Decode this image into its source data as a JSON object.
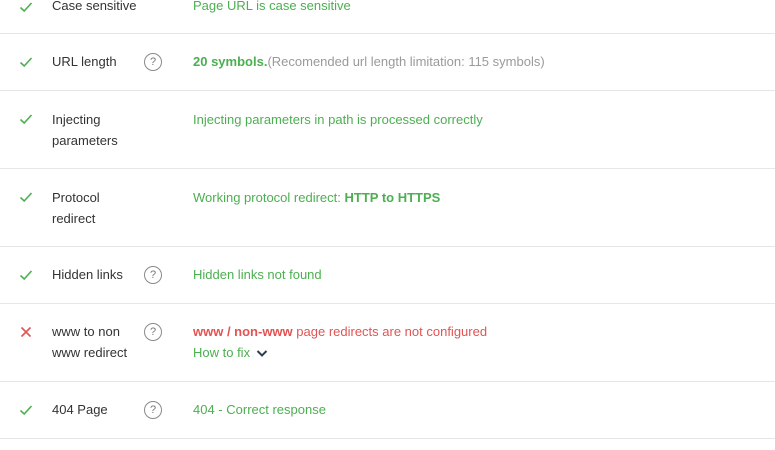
{
  "colors": {
    "pass": "#4caf50",
    "fail": "#e25353",
    "muted": "#9a9a9a",
    "divider": "#e6e6e6"
  },
  "rows": [
    {
      "name": "Case sensitive",
      "status": "pass",
      "result": "Page URL is case sensitive"
    },
    {
      "name": "URL length",
      "status": "pass",
      "help": "?",
      "result_strong": "20 symbols.",
      "result_note": "(Recomended url length limitation: 115 symbols)"
    },
    {
      "name_lines": [
        "Injecting",
        "parameters"
      ],
      "status": "pass",
      "result": "Injecting parameters in path is processed correctly"
    },
    {
      "name_lines": [
        "Protocol",
        "redirect"
      ],
      "status": "pass",
      "result_prefix": "Working protocol redirect: ",
      "result_strong": "HTTP to HTTPS"
    },
    {
      "name": "Hidden links",
      "status": "pass",
      "help": "?",
      "result": "Hidden links not found"
    },
    {
      "name_lines": [
        "www to non",
        "www redirect"
      ],
      "status": "fail",
      "help": "?",
      "result_strong": "www / non-www",
      "result_rest": " page redirects are not configured",
      "fix_link": "How to fix"
    },
    {
      "name": "404 Page",
      "status": "pass",
      "help": "?",
      "result": "404 - Correct response"
    }
  ]
}
